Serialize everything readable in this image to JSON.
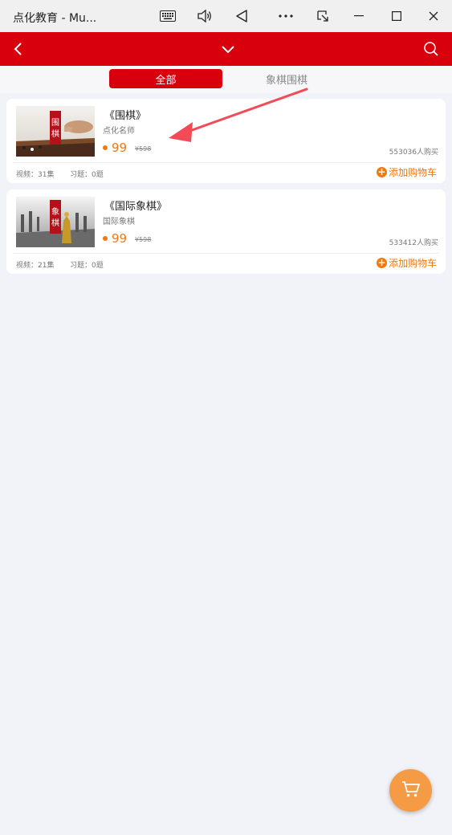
{
  "window": {
    "title": "点化教育 - Mu...",
    "icons": [
      "keyboard-icon",
      "volume-icon",
      "back-triangle-icon",
      "more-icon",
      "snap-icon",
      "minimize-icon",
      "maximize-icon",
      "close-icon"
    ]
  },
  "appbar": {
    "icons": [
      "back-chevron-icon",
      "dropdown-chevron-icon",
      "search-icon"
    ],
    "color": "#d9000d"
  },
  "tabs": [
    {
      "label": "全部",
      "active": true
    },
    {
      "label": "象棋围棋",
      "active": false
    }
  ],
  "courses": [
    {
      "title": "《围棋》",
      "subtitle": "点化名师",
      "price": "99",
      "original_price": "598",
      "buyers": "553036人购买",
      "videos": "视频：31集",
      "exercises": "习题：0题",
      "add_label": "添加购物车",
      "thumb_text": "围棋"
    },
    {
      "title": "《国际象棋》",
      "subtitle": "国际象棋",
      "price": "99",
      "original_price": "598",
      "buyers": "533412人购买",
      "videos": "视频：21集",
      "exercises": "习题：0题",
      "add_label": "添加购物车",
      "thumb_text": "象棋"
    }
  ],
  "cart_fab": {
    "icon": "cart-icon",
    "color": "#f59a45"
  },
  "accent_color": "#ee7a12"
}
